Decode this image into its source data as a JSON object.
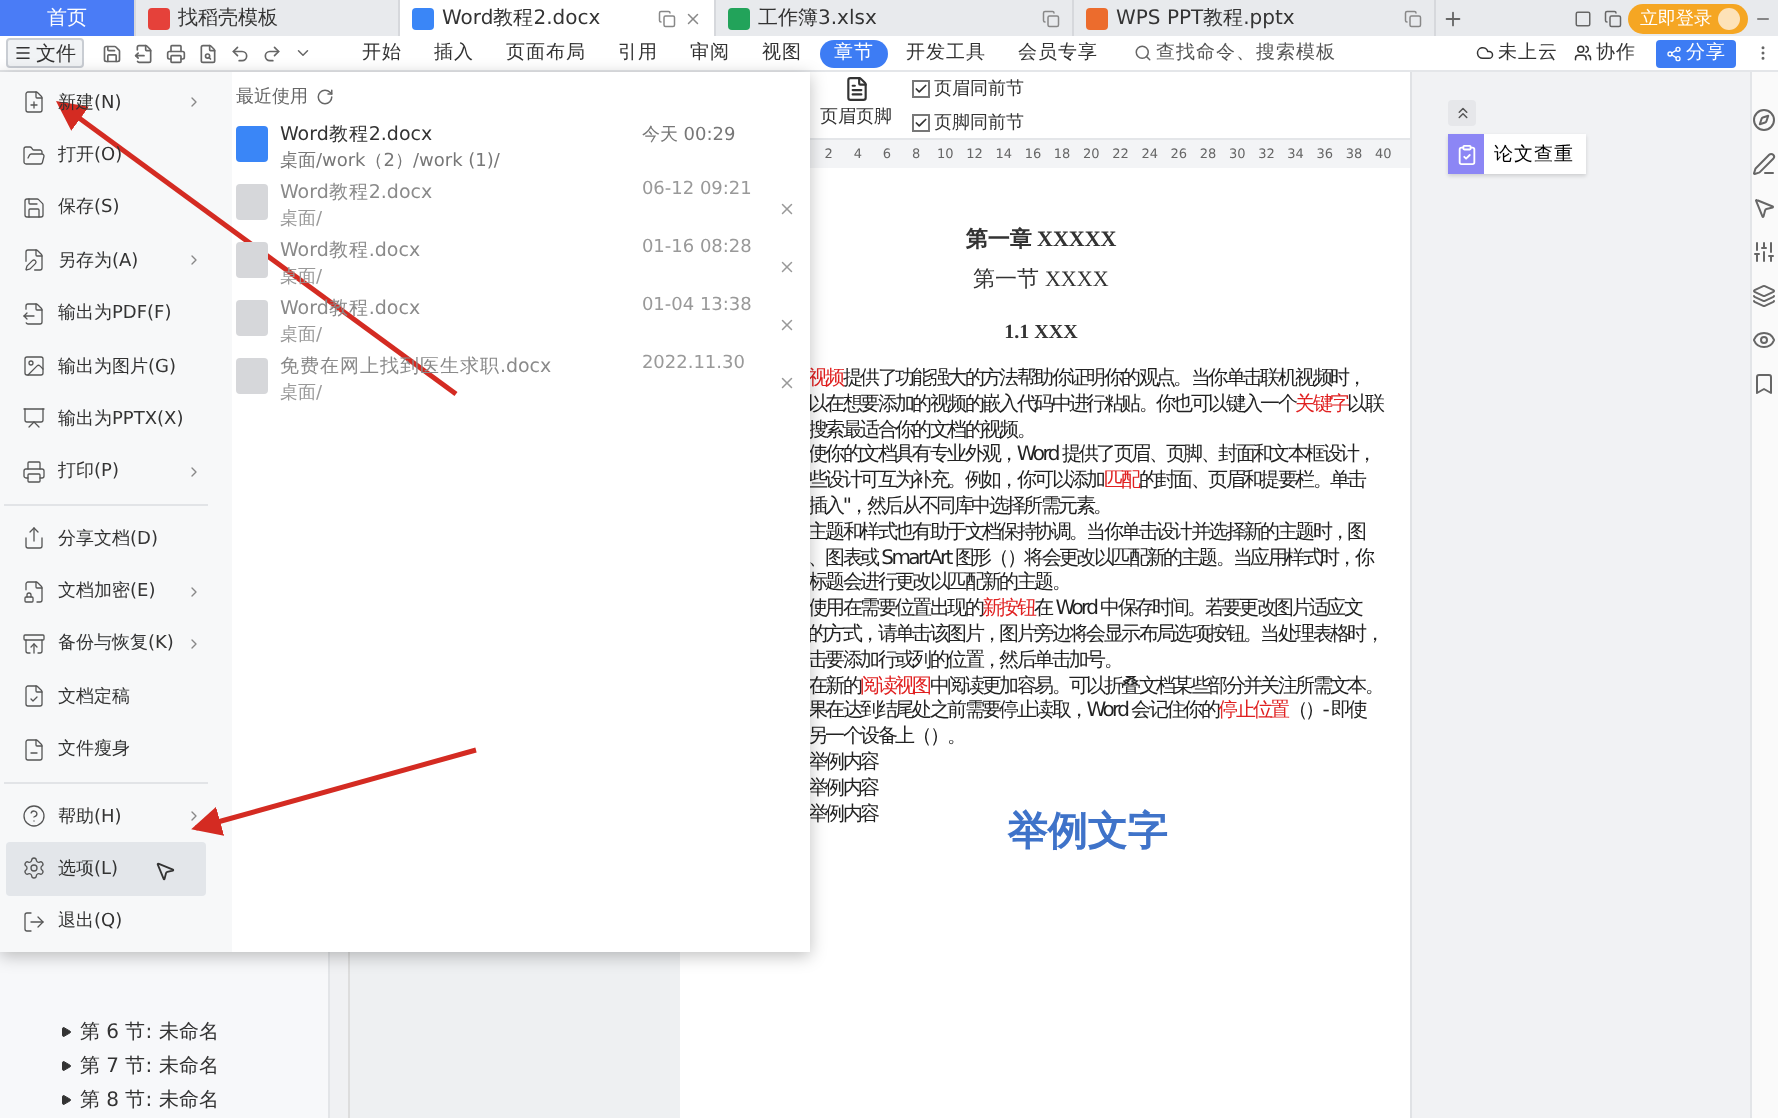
{
  "window_tabs": [
    {
      "label": "首页",
      "kind": "home",
      "selected": false
    },
    {
      "label": "找稻壳模板",
      "kind": "template",
      "selected": false
    },
    {
      "label": "Word教程2.docx",
      "kind": "doc",
      "selected": true
    },
    {
      "label": "工作簿3.xlsx",
      "kind": "sheet",
      "selected": false
    },
    {
      "label": "WPS PPT教程.pptx",
      "kind": "ppt",
      "selected": false
    }
  ],
  "login_button": "立即登录",
  "file_button": "文件",
  "ribbon_tabs": [
    {
      "label": "开始",
      "selected": false
    },
    {
      "label": "插入",
      "selected": false
    },
    {
      "label": "页面布局",
      "selected": false
    },
    {
      "label": "引用",
      "selected": false
    },
    {
      "label": "审阅",
      "selected": false
    },
    {
      "label": "视图",
      "selected": false
    },
    {
      "label": "章节",
      "selected": true
    },
    {
      "label": "开发工具",
      "selected": false
    },
    {
      "label": "会员专享",
      "selected": false
    }
  ],
  "search": {
    "placeholder": "查找命令、搜索模板"
  },
  "toolbar_right": {
    "cloud": "未上云",
    "collab": "协作",
    "share": "分享"
  },
  "ribbon_panel": {
    "header_footer": "页眉页脚",
    "checkboxes": [
      {
        "label": "页眉同前节",
        "checked": true
      },
      {
        "label": "页脚同前节",
        "checked": true
      }
    ]
  },
  "ruler": [
    "2",
    "4",
    "6",
    "8",
    "10",
    "12",
    "14",
    "16",
    "18",
    "20",
    "22",
    "24",
    "26",
    "28",
    "30",
    "32",
    "34",
    "36",
    "38",
    "40"
  ],
  "file_menu": {
    "sections": [
      [
        {
          "label": "新建(N)",
          "submenu": true,
          "selected": false
        },
        {
          "label": "打开(O)",
          "submenu": false,
          "selected": false
        },
        {
          "label": "保存(S)",
          "submenu": false,
          "selected": false
        },
        {
          "label": "另存为(A)",
          "submenu": true,
          "selected": false
        },
        {
          "label": "输出为PDF(F)",
          "submenu": false,
          "selected": false
        },
        {
          "label": "输出为图片(G)",
          "submenu": false,
          "selected": false
        },
        {
          "label": "输出为PPTX(X)",
          "submenu": false,
          "selected": false
        },
        {
          "label": "打印(P)",
          "submenu": true,
          "selected": false
        }
      ],
      [
        {
          "label": "分享文档(D)",
          "submenu": false,
          "selected": false
        },
        {
          "label": "文档加密(E)",
          "submenu": true,
          "selected": false
        },
        {
          "label": "备份与恢复(K)",
          "submenu": true,
          "selected": false
        },
        {
          "label": "文档定稿",
          "submenu": false,
          "selected": false
        },
        {
          "label": "文件瘦身",
          "submenu": false,
          "selected": false
        }
      ],
      [
        {
          "label": "帮助(H)",
          "submenu": true,
          "selected": false
        },
        {
          "label": "选项(L)",
          "submenu": false,
          "selected": true
        },
        {
          "label": "退出(Q)",
          "submenu": false,
          "selected": false
        }
      ]
    ],
    "recent_title": "最近使用",
    "recent": [
      {
        "name": "Word教程2.docx",
        "path": "桌面/work（2）/work (1)/",
        "time": "今天 00:29",
        "active": true
      },
      {
        "name": "Word教程2.docx",
        "path": "桌面/",
        "time": "06-12 09:21",
        "active": false
      },
      {
        "name": "Word教程.docx",
        "path": "桌面/",
        "time": "01-16 08:28",
        "active": false
      },
      {
        "name": "Word教程.docx",
        "path": "桌面/",
        "time": "01-04 13:38",
        "active": false
      },
      {
        "name": "免费在网上找到医生求职.docx",
        "path": "桌面/",
        "time": "2022.11.30",
        "active": false
      }
    ]
  },
  "nav_pane": [
    "第 6 节: 未命名",
    "第 7 节: 未命名",
    "第 8 节: 未命名"
  ],
  "document": {
    "headings": [
      "第一章  XXXXX",
      "第一节  XXXX",
      "1.1 XXX"
    ],
    "lines": [
      [
        {
          "text": "视频",
          "highlight": true
        },
        {
          "text": "提供了功能强大的方法帮助你证明你的观点。当你单击联机视频时，",
          "highlight": false
        }
      ],
      [
        {
          "text": "以在想要添加的视频的嵌入代码中进行粘贴。你也可以键入一个",
          "highlight": false
        },
        {
          "text": "关键字",
          "highlight": true
        },
        {
          "text": "以联",
          "highlight": false
        }
      ],
      [
        {
          "text": "搜索最适合你的文档的视频。",
          "highlight": false
        }
      ],
      [
        {
          "text": "使你的文档具有专业外观，Word 提供了页眉、页脚、封面和文本框设计，",
          "highlight": false
        }
      ],
      [
        {
          "text": "些设计可互为补充。例如，你可以添加",
          "highlight": false
        },
        {
          "text": "匹配",
          "highlight": true
        },
        {
          "text": "的封面、页眉和提要栏。单击",
          "highlight": false
        }
      ],
      [
        {
          "text": "插入\"，然后从不同库中选择所需元素。",
          "highlight": false
        }
      ],
      [
        {
          "text": "主题和样式也有助于文档保持协调。当你单击设计并选择新的主题时，图",
          "highlight": false
        }
      ],
      [
        {
          "text": "、图表或 SmartArt 图形（）将会更改以匹配新的主题。当应用样式时，你",
          "highlight": false
        }
      ],
      [
        {
          "text": "标题会进行更改以匹配新的主题。",
          "highlight": false
        }
      ],
      [
        {
          "text": "使用在需要位置出现的",
          "highlight": false
        },
        {
          "text": "新按钮",
          "highlight": true
        },
        {
          "text": "在 Word 中保存时间。若要更改图片适应文",
          "highlight": false
        }
      ],
      [
        {
          "text": "的方式，请单击该图片，图片旁边将会显示布局选项按钮。当处理表格时，",
          "highlight": false
        }
      ],
      [
        {
          "text": "击要添加行或列的位置，然后单击加号。",
          "highlight": false
        }
      ],
      [
        {
          "text": "在新的",
          "highlight": false
        },
        {
          "text": "阅读视图",
          "highlight": true
        },
        {
          "text": "中阅读更加容易。可以折叠文档某些部分并关注所需文本。",
          "highlight": false
        }
      ],
      [
        {
          "text": "果在达到结尾处之前需要停止读取，Word 会记住你的",
          "highlight": false
        },
        {
          "text": "停止位置",
          "highlight": true
        },
        {
          "text": "（）- 即使",
          "highlight": false
        }
      ],
      [
        {
          "text": "另一个设备上（）。",
          "highlight": false
        }
      ],
      [
        {
          "text": "举例内容",
          "highlight": false
        }
      ],
      [
        {
          "text": "举例内容",
          "highlight": false
        }
      ],
      [
        {
          "text": "举例内容",
          "highlight": false
        }
      ]
    ],
    "big_text": "举例文字"
  },
  "side_panel": {
    "card": "论文查重"
  }
}
